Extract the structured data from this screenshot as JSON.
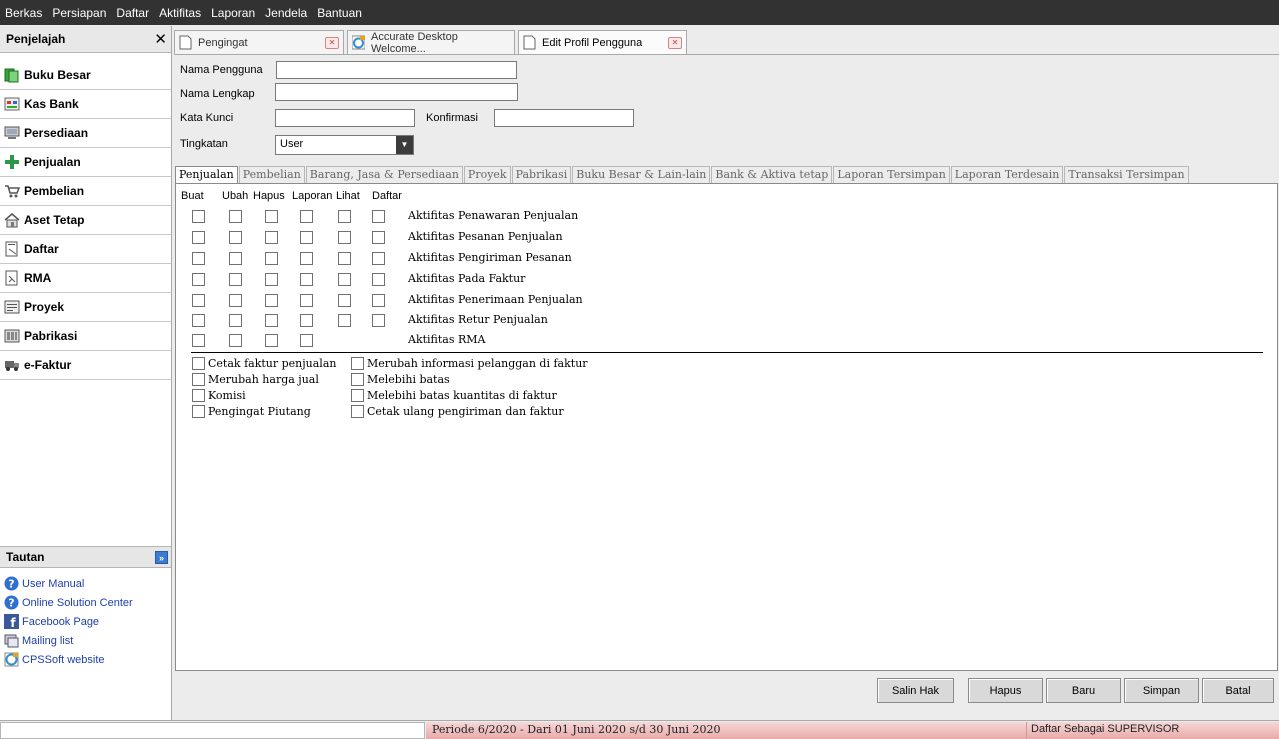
{
  "menu": [
    "Berkas",
    "Persiapan",
    "Daftar",
    "Aktifitas",
    "Laporan",
    "Jendela",
    "Bantuan"
  ],
  "sidebar": {
    "title": "Penjelajah",
    "close_glyph": "✕",
    "items": [
      {
        "label": "Buku Besar",
        "icon": "ledger-icon"
      },
      {
        "label": "Kas Bank",
        "icon": "cash-bank-icon"
      },
      {
        "label": "Persediaan",
        "icon": "inventory-icon"
      },
      {
        "label": "Penjualan",
        "icon": "sales-icon"
      },
      {
        "label": "Pembelian",
        "icon": "cart-icon"
      },
      {
        "label": "Aset Tetap",
        "icon": "house-icon"
      },
      {
        "label": "Daftar",
        "icon": "list-icon"
      },
      {
        "label": "RMA",
        "icon": "rma-icon"
      },
      {
        "label": "Proyek",
        "icon": "project-icon"
      },
      {
        "label": "Pabrikasi",
        "icon": "factory-icon"
      },
      {
        "label": "e-Faktur",
        "icon": "truck-icon"
      }
    ]
  },
  "tautan": {
    "title": "Tautan",
    "toggle_glyph": "»",
    "links": [
      {
        "label": "User Manual",
        "icon": "help-icon"
      },
      {
        "label": "Online Solution Center",
        "icon": "help-icon"
      },
      {
        "label": "Facebook Page",
        "icon": "facebook-icon"
      },
      {
        "label": "Mailing list",
        "icon": "mailing-list-icon"
      },
      {
        "label": "CPSSoft website",
        "icon": "web-icon"
      }
    ]
  },
  "doc_tabs": [
    {
      "title": "Pengingat",
      "closable": true,
      "active": false
    },
    {
      "title": "Accurate Desktop Welcome...",
      "closable": false,
      "active": false
    },
    {
      "title": "Edit Profil Pengguna",
      "closable": true,
      "active": true
    }
  ],
  "tab_close_glyph": "✕",
  "form": {
    "username_label": "Nama Pengguna",
    "username_value": "",
    "fullname_label": "Nama Lengkap",
    "fullname_value": "",
    "password_label": "Kata Kunci",
    "password_value": "",
    "confirm_label": "Konfirmasi",
    "confirm_value": "",
    "level_label": "Tingkatan",
    "level_value": "User",
    "select_arrow": "▼"
  },
  "perm_tabs": [
    "Penjualan",
    "Pembelian",
    "Barang, Jasa & Persediaan",
    "Proyek",
    "Pabrikasi",
    "Buku Besar & Lain-lain",
    "Bank & Aktiva tetap",
    "Laporan Tersimpan",
    "Laporan Terdesain",
    "Transaksi Tersimpan"
  ],
  "perm_columns": [
    "Buat",
    "Ubah",
    "Hapus",
    "Laporan",
    "Lihat",
    "Daftar"
  ],
  "perm_rows": [
    {
      "label": "Aktifitas Penawaran Penjualan",
      "checks": [
        false,
        false,
        false,
        false,
        false,
        false
      ]
    },
    {
      "label": "Aktifitas Pesanan Penjualan",
      "checks": [
        false,
        false,
        false,
        false,
        false,
        false
      ]
    },
    {
      "label": "Aktifitas Pengiriman Pesanan",
      "checks": [
        false,
        false,
        false,
        false,
        false,
        false
      ]
    },
    {
      "label": "Aktifitas Pada Faktur",
      "checks": [
        false,
        false,
        false,
        false,
        false,
        false
      ]
    },
    {
      "label": "Aktifitas Penerimaan Penjualan",
      "checks": [
        false,
        false,
        false,
        false,
        false,
        false
      ]
    },
    {
      "label": "Aktifitas Retur Penjualan",
      "checks": [
        false,
        false,
        false,
        false,
        false,
        false
      ]
    },
    {
      "label": "Aktifitas RMA",
      "checks": [
        false,
        false,
        false,
        false
      ]
    }
  ],
  "options_left": [
    "Cetak faktur penjualan",
    "Merubah harga jual",
    "Komisi",
    "Pengingat Piutang"
  ],
  "options_right": [
    "Merubah informasi pelanggan di faktur",
    "Melebihi batas",
    "Melebihi batas kuantitas di faktur",
    "Cetak ulang pengiriman dan faktur"
  ],
  "buttons": [
    "Salin Hak",
    "Hapus",
    "Baru",
    "Simpan",
    "Batal"
  ],
  "status": {
    "period": "Periode 6/2020 - Dari 01 Juni 2020 s/d 30 Juni 2020",
    "user": "Daftar Sebagai SUPERVISOR"
  }
}
